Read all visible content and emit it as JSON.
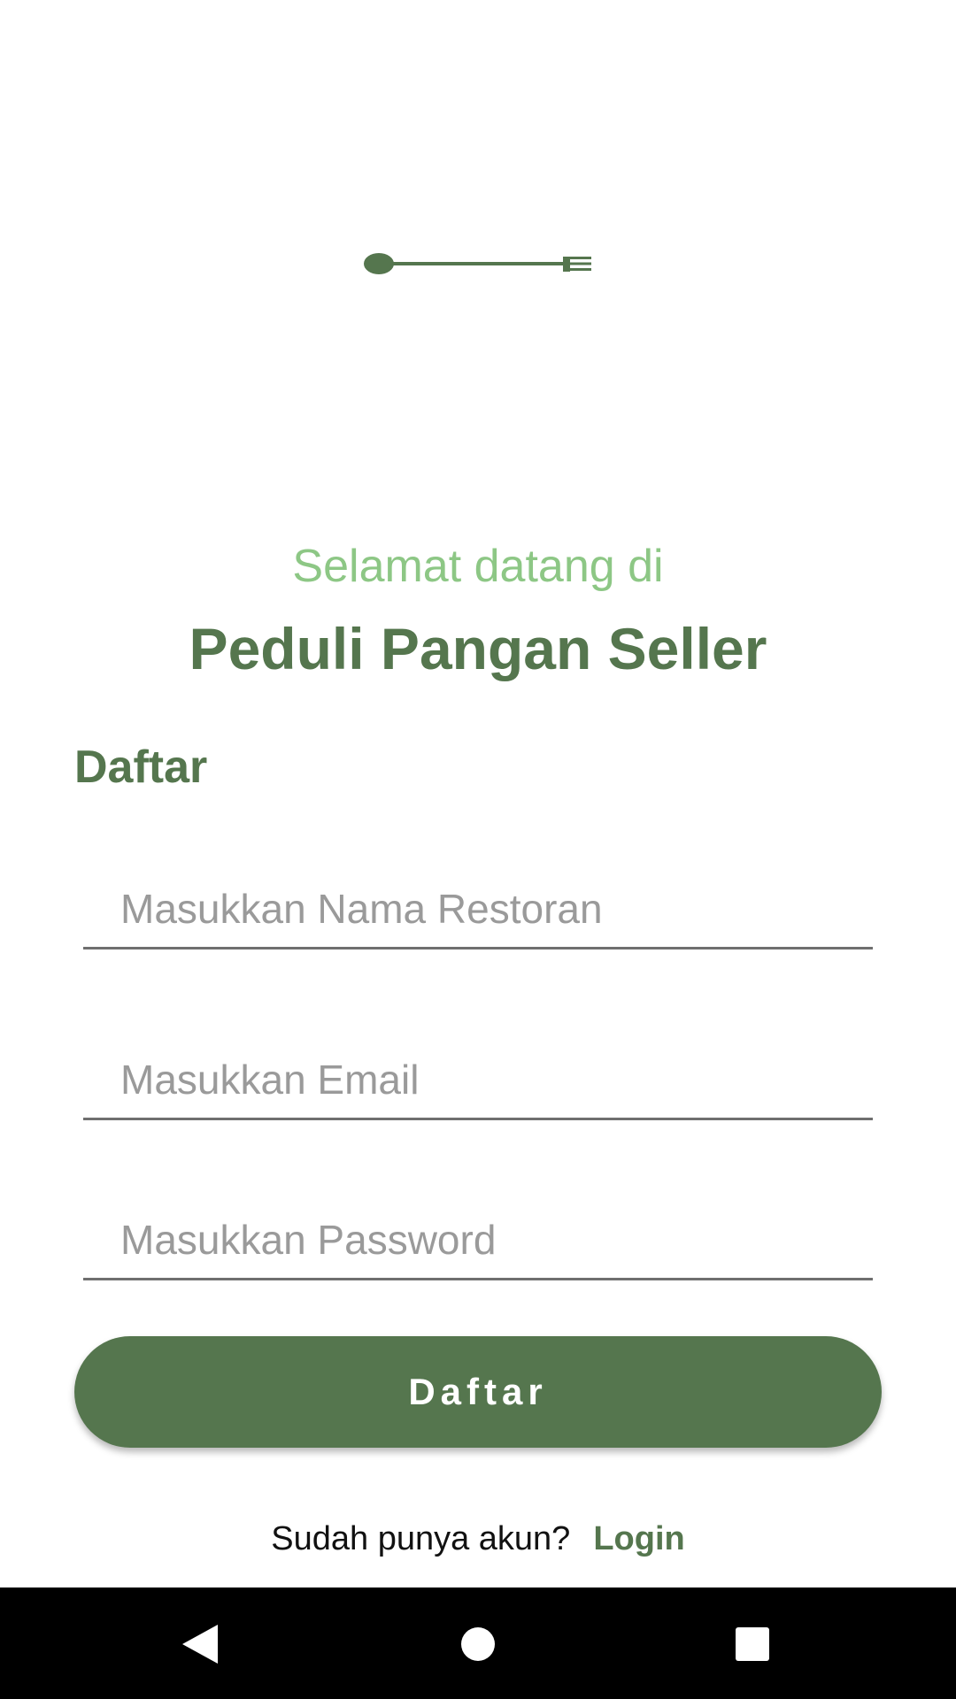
{
  "logo": {
    "icon": "spoon-fork-icon",
    "color": "#55764e"
  },
  "welcome_text": "Selamat datang di",
  "app_title": "Peduli Pangan Seller",
  "form": {
    "title": "Daftar",
    "fields": [
      {
        "placeholder": "Masukkan Nama Restoran",
        "value": ""
      },
      {
        "placeholder": "Masukkan Email",
        "value": ""
      },
      {
        "placeholder": "Masukkan Password",
        "value": ""
      }
    ],
    "submit_label": "Daftar"
  },
  "login_prompt": {
    "text": "Sudah punya akun?",
    "link": "Login"
  },
  "navbar": {
    "back_icon": "back-triangle-icon",
    "home_icon": "home-circle-icon",
    "recents_icon": "recents-square-icon"
  },
  "colors": {
    "primary": "#55764e",
    "accent_light": "#8dc785",
    "background": "#ffffff"
  }
}
